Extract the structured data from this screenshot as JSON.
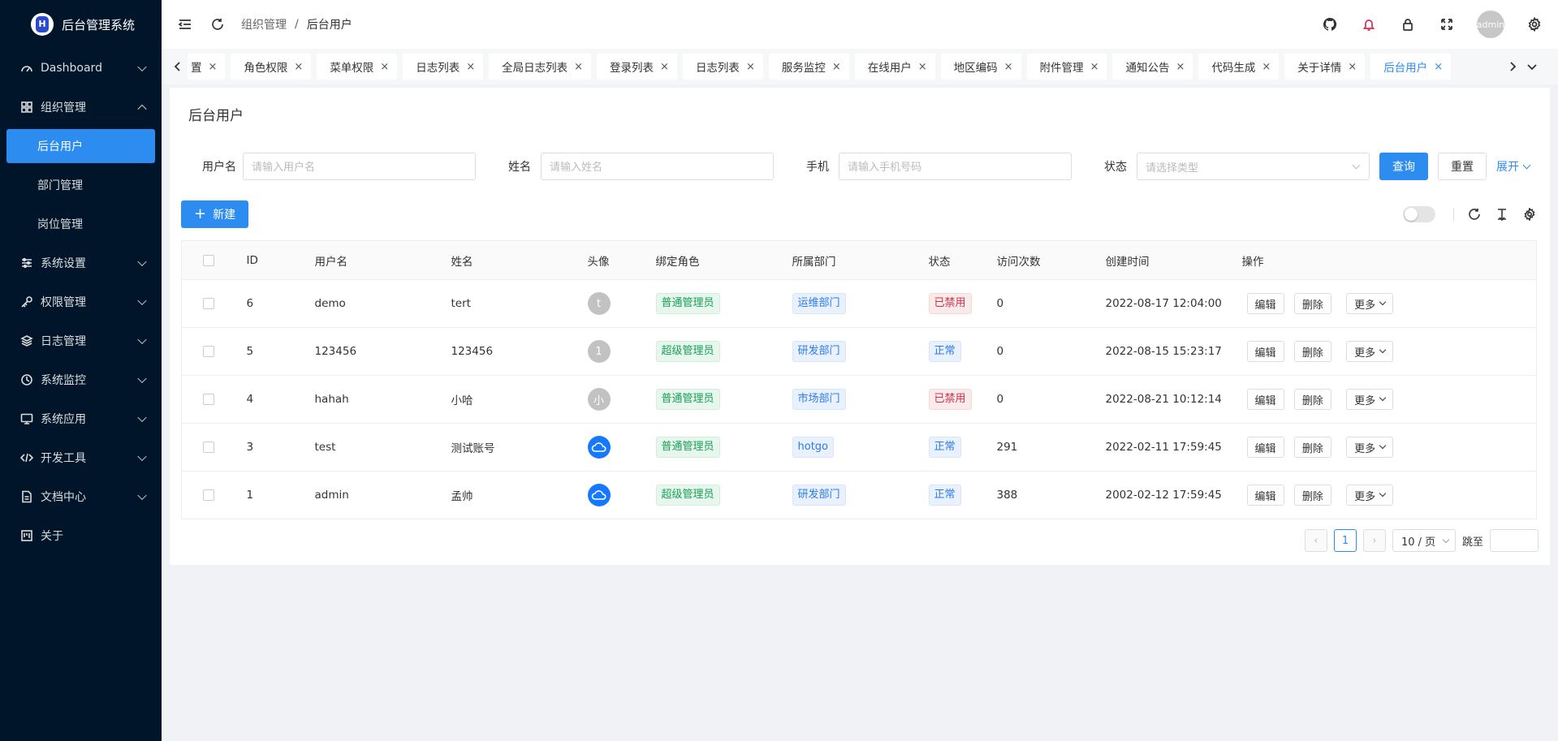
{
  "app": {
    "title": "后台管理系统",
    "logo_letter": "H"
  },
  "sidebar": {
    "items": [
      {
        "label": "Dashboard",
        "icon": "dashboard-icon"
      },
      {
        "label": "组织管理",
        "icon": "grid-icon",
        "open": true,
        "children": [
          {
            "label": "后台用户",
            "active": true
          },
          {
            "label": "部门管理"
          },
          {
            "label": "岗位管理"
          }
        ]
      },
      {
        "label": "系统设置",
        "icon": "sliders-icon"
      },
      {
        "label": "权限管理",
        "icon": "key-icon"
      },
      {
        "label": "日志管理",
        "icon": "layers-icon"
      },
      {
        "label": "系统监控",
        "icon": "clock-icon"
      },
      {
        "label": "系统应用",
        "icon": "monitor-icon"
      },
      {
        "label": "开发工具",
        "icon": "code-icon"
      },
      {
        "label": "文档中心",
        "icon": "file-icon"
      },
      {
        "label": "关于",
        "icon": "project-icon"
      }
    ]
  },
  "header": {
    "breadcrumb": [
      "组织管理",
      "后台用户"
    ],
    "avatar_text": "admin"
  },
  "tabs": [
    {
      "label": "置"
    },
    {
      "label": "角色权限"
    },
    {
      "label": "菜单权限"
    },
    {
      "label": "日志列表"
    },
    {
      "label": "全局日志列表"
    },
    {
      "label": "登录列表"
    },
    {
      "label": "日志列表"
    },
    {
      "label": "服务监控"
    },
    {
      "label": "在线用户"
    },
    {
      "label": "地区编码"
    },
    {
      "label": "附件管理"
    },
    {
      "label": "通知公告"
    },
    {
      "label": "代码生成"
    },
    {
      "label": "关于详情"
    },
    {
      "label": "后台用户",
      "active": true
    }
  ],
  "page": {
    "title": "后台用户"
  },
  "search": {
    "username_label": "用户名",
    "username_placeholder": "请输入用户名",
    "name_label": "姓名",
    "name_placeholder": "请输入姓名",
    "phone_label": "手机",
    "phone_placeholder": "请输入手机号码",
    "status_label": "状态",
    "status_placeholder": "请选择类型",
    "query": "查询",
    "reset": "重置",
    "expand": "展开"
  },
  "toolbar": {
    "new_label": "新建"
  },
  "table": {
    "columns": [
      "ID",
      "用户名",
      "姓名",
      "头像",
      "绑定角色",
      "所属部门",
      "状态",
      "访问次数",
      "创建时间",
      "操作"
    ],
    "rows": [
      {
        "id": "6",
        "username": "demo",
        "name": "tert",
        "avatar": "t",
        "avatar_type": "letter",
        "role": "普通管理员",
        "dept": "运维部门",
        "status": "已禁用",
        "status_type": "red",
        "visits": "0",
        "created": "2022-08-17 12:04:00"
      },
      {
        "id": "5",
        "username": "123456",
        "name": "123456",
        "avatar": "1",
        "avatar_type": "letter",
        "role": "超级管理员",
        "dept": "研发部门",
        "status": "正常",
        "status_type": "blue",
        "visits": "0",
        "created": "2022-08-15 15:23:17"
      },
      {
        "id": "4",
        "username": "hahah",
        "name": "小哈",
        "avatar": "小",
        "avatar_type": "letter",
        "role": "普通管理员",
        "dept": "市场部门",
        "status": "已禁用",
        "status_type": "red",
        "visits": "0",
        "created": "2022-08-21 10:12:14"
      },
      {
        "id": "3",
        "username": "test",
        "name": "测试账号",
        "avatar": "cloud-icon",
        "avatar_type": "cloud",
        "role": "普通管理员",
        "dept": "hotgo",
        "status": "正常",
        "status_type": "blue",
        "visits": "291",
        "created": "2022-02-11 17:59:45"
      },
      {
        "id": "1",
        "username": "admin",
        "name": "孟帅",
        "avatar": "cloud-icon",
        "avatar_type": "cloud",
        "role": "超级管理员",
        "dept": "研发部门",
        "status": "正常",
        "status_type": "blue",
        "visits": "388",
        "created": "2002-02-12 17:59:45"
      }
    ],
    "actions": {
      "edit": "编辑",
      "delete": "删除",
      "more": "更多"
    }
  },
  "pagination": {
    "current": "1",
    "page_size": "10 / 页",
    "jump_label": "跳至"
  },
  "colors": {
    "primary": "#2d8cf0",
    "sidebar_bg": "#001529"
  }
}
